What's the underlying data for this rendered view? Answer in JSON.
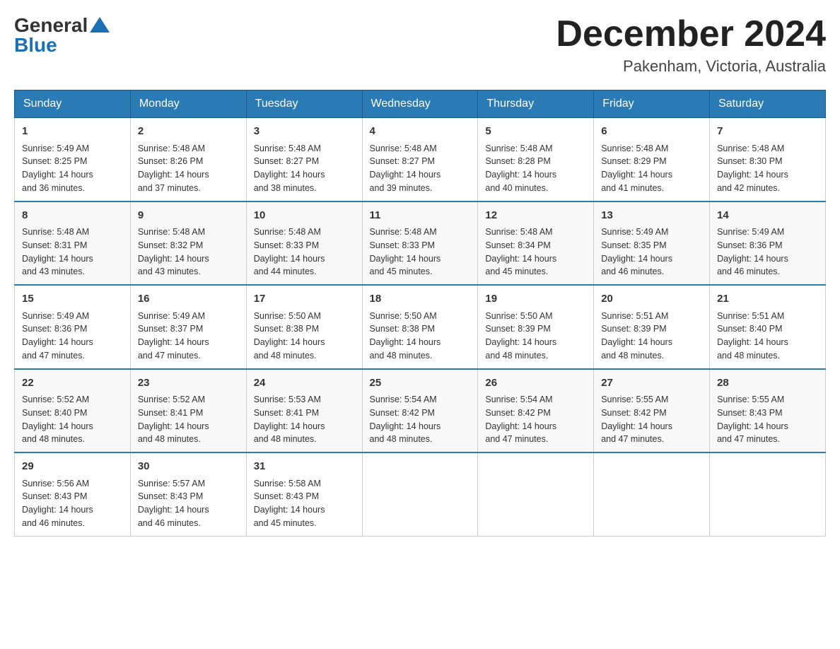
{
  "logo": {
    "general": "General",
    "arrow": "▲",
    "blue": "Blue"
  },
  "title": {
    "month_year": "December 2024",
    "location": "Pakenham, Victoria, Australia"
  },
  "header_days": [
    "Sunday",
    "Monday",
    "Tuesday",
    "Wednesday",
    "Thursday",
    "Friday",
    "Saturday"
  ],
  "weeks": [
    [
      {
        "day": "1",
        "sunrise": "5:49 AM",
        "sunset": "8:25 PM",
        "daylight": "14 hours and 36 minutes."
      },
      {
        "day": "2",
        "sunrise": "5:48 AM",
        "sunset": "8:26 PM",
        "daylight": "14 hours and 37 minutes."
      },
      {
        "day": "3",
        "sunrise": "5:48 AM",
        "sunset": "8:27 PM",
        "daylight": "14 hours and 38 minutes."
      },
      {
        "day": "4",
        "sunrise": "5:48 AM",
        "sunset": "8:27 PM",
        "daylight": "14 hours and 39 minutes."
      },
      {
        "day": "5",
        "sunrise": "5:48 AM",
        "sunset": "8:28 PM",
        "daylight": "14 hours and 40 minutes."
      },
      {
        "day": "6",
        "sunrise": "5:48 AM",
        "sunset": "8:29 PM",
        "daylight": "14 hours and 41 minutes."
      },
      {
        "day": "7",
        "sunrise": "5:48 AM",
        "sunset": "8:30 PM",
        "daylight": "14 hours and 42 minutes."
      }
    ],
    [
      {
        "day": "8",
        "sunrise": "5:48 AM",
        "sunset": "8:31 PM",
        "daylight": "14 hours and 43 minutes."
      },
      {
        "day": "9",
        "sunrise": "5:48 AM",
        "sunset": "8:32 PM",
        "daylight": "14 hours and 43 minutes."
      },
      {
        "day": "10",
        "sunrise": "5:48 AM",
        "sunset": "8:33 PM",
        "daylight": "14 hours and 44 minutes."
      },
      {
        "day": "11",
        "sunrise": "5:48 AM",
        "sunset": "8:33 PM",
        "daylight": "14 hours and 45 minutes."
      },
      {
        "day": "12",
        "sunrise": "5:48 AM",
        "sunset": "8:34 PM",
        "daylight": "14 hours and 45 minutes."
      },
      {
        "day": "13",
        "sunrise": "5:49 AM",
        "sunset": "8:35 PM",
        "daylight": "14 hours and 46 minutes."
      },
      {
        "day": "14",
        "sunrise": "5:49 AM",
        "sunset": "8:36 PM",
        "daylight": "14 hours and 46 minutes."
      }
    ],
    [
      {
        "day": "15",
        "sunrise": "5:49 AM",
        "sunset": "8:36 PM",
        "daylight": "14 hours and 47 minutes."
      },
      {
        "day": "16",
        "sunrise": "5:49 AM",
        "sunset": "8:37 PM",
        "daylight": "14 hours and 47 minutes."
      },
      {
        "day": "17",
        "sunrise": "5:50 AM",
        "sunset": "8:38 PM",
        "daylight": "14 hours and 48 minutes."
      },
      {
        "day": "18",
        "sunrise": "5:50 AM",
        "sunset": "8:38 PM",
        "daylight": "14 hours and 48 minutes."
      },
      {
        "day": "19",
        "sunrise": "5:50 AM",
        "sunset": "8:39 PM",
        "daylight": "14 hours and 48 minutes."
      },
      {
        "day": "20",
        "sunrise": "5:51 AM",
        "sunset": "8:39 PM",
        "daylight": "14 hours and 48 minutes."
      },
      {
        "day": "21",
        "sunrise": "5:51 AM",
        "sunset": "8:40 PM",
        "daylight": "14 hours and 48 minutes."
      }
    ],
    [
      {
        "day": "22",
        "sunrise": "5:52 AM",
        "sunset": "8:40 PM",
        "daylight": "14 hours and 48 minutes."
      },
      {
        "day": "23",
        "sunrise": "5:52 AM",
        "sunset": "8:41 PM",
        "daylight": "14 hours and 48 minutes."
      },
      {
        "day": "24",
        "sunrise": "5:53 AM",
        "sunset": "8:41 PM",
        "daylight": "14 hours and 48 minutes."
      },
      {
        "day": "25",
        "sunrise": "5:54 AM",
        "sunset": "8:42 PM",
        "daylight": "14 hours and 48 minutes."
      },
      {
        "day": "26",
        "sunrise": "5:54 AM",
        "sunset": "8:42 PM",
        "daylight": "14 hours and 47 minutes."
      },
      {
        "day": "27",
        "sunrise": "5:55 AM",
        "sunset": "8:42 PM",
        "daylight": "14 hours and 47 minutes."
      },
      {
        "day": "28",
        "sunrise": "5:55 AM",
        "sunset": "8:43 PM",
        "daylight": "14 hours and 47 minutes."
      }
    ],
    [
      {
        "day": "29",
        "sunrise": "5:56 AM",
        "sunset": "8:43 PM",
        "daylight": "14 hours and 46 minutes."
      },
      {
        "day": "30",
        "sunrise": "5:57 AM",
        "sunset": "8:43 PM",
        "daylight": "14 hours and 46 minutes."
      },
      {
        "day": "31",
        "sunrise": "5:58 AM",
        "sunset": "8:43 PM",
        "daylight": "14 hours and 45 minutes."
      },
      null,
      null,
      null,
      null
    ]
  ],
  "labels": {
    "sunrise": "Sunrise:",
    "sunset": "Sunset:",
    "daylight": "Daylight:"
  }
}
